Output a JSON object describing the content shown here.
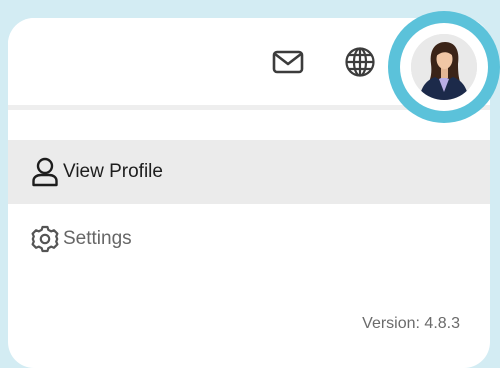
{
  "menu": {
    "view_profile": "View Profile",
    "settings": "Settings"
  },
  "footer": {
    "version": "Version: 4.8.3"
  },
  "icons": {
    "mail": "mail-icon",
    "globe": "globe-icon",
    "user": "user-icon",
    "settings": "gear-icon"
  },
  "colors": {
    "page_background": "#d3ecf3",
    "avatar_ring": "#5bc2da",
    "active_item": "#ebebeb"
  }
}
